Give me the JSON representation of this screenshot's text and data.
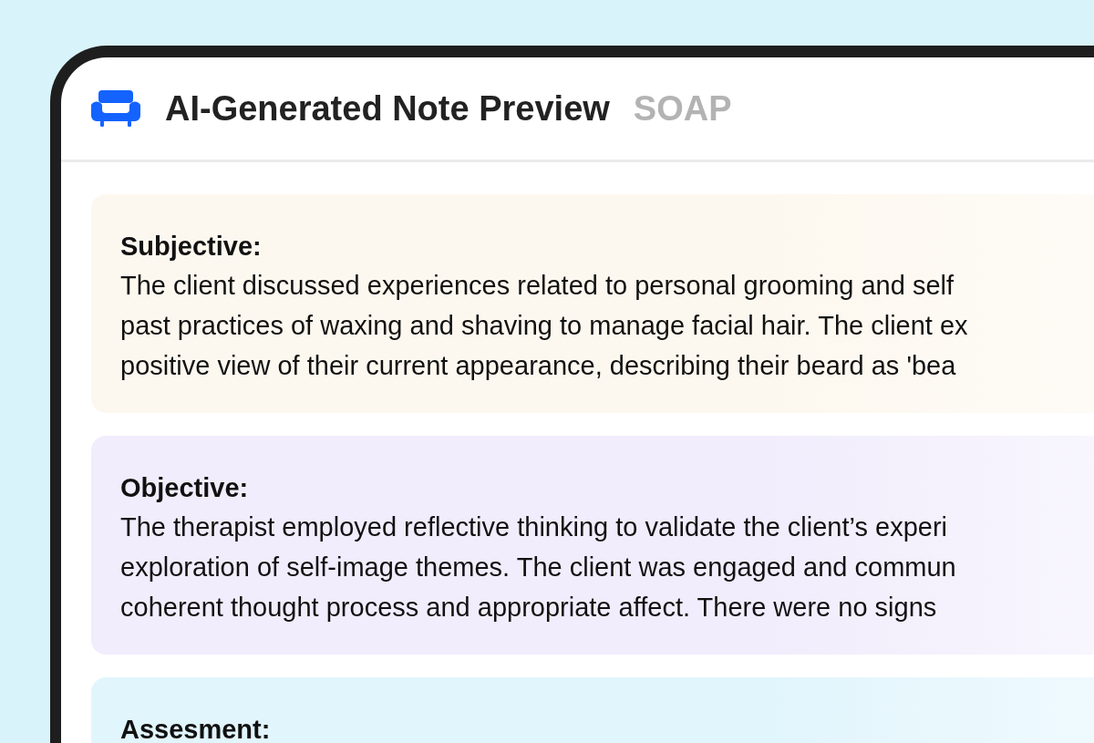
{
  "header": {
    "title": "AI-Generated Note Preview",
    "note_type": "SOAP"
  },
  "sections": [
    {
      "heading": "Subjective:",
      "color": "#fdf8ef",
      "lines": [
        "The client discussed experiences related to personal grooming and self",
        "past practices of waxing and shaving to manage facial hair. The client ex",
        "positive view of their current appearance, describing their beard as 'bea"
      ]
    },
    {
      "heading": "Objective:",
      "color": "#f1edfc",
      "lines": [
        "The therapist employed reflective thinking to validate the client’s experi",
        "exploration of self-image themes. The client was engaged and commun",
        "coherent thought process and appropriate affect. There were no signs"
      ]
    },
    {
      "heading": "Assesment:",
      "color": "#e1f5fc"
    }
  ]
}
